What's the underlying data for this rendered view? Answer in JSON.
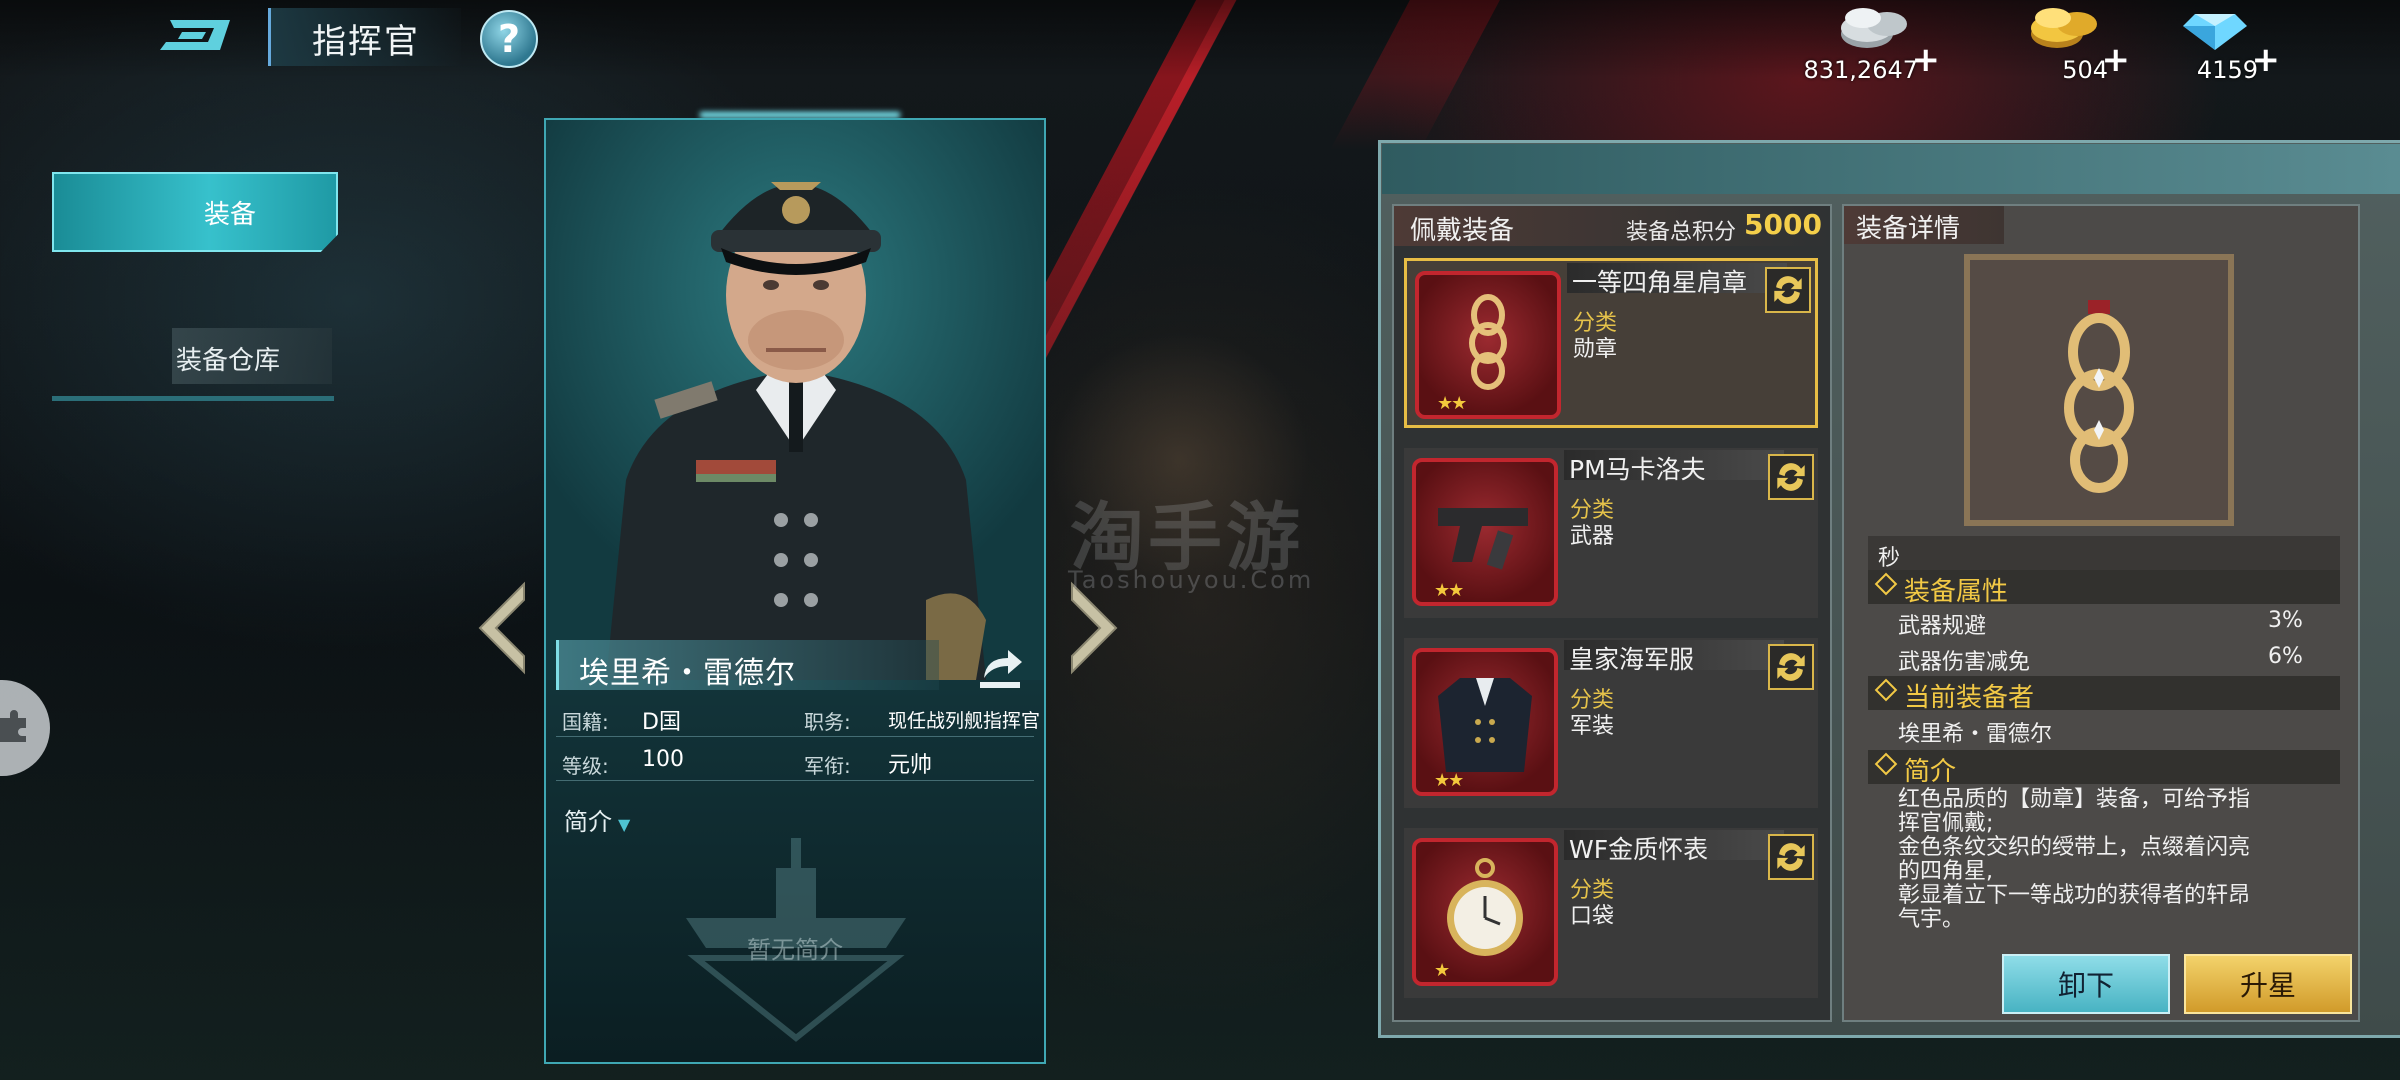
{
  "header": {
    "title": "指挥官"
  },
  "currencies": [
    {
      "name": "silver",
      "value": "831,2647",
      "plus": "+"
    },
    {
      "name": "gold",
      "value": "504",
      "plus": "+"
    },
    {
      "name": "diamond",
      "value": "4159",
      "plus": "+"
    }
  ],
  "menu": {
    "equip": "装备",
    "warehouse": "装备仓库"
  },
  "commander": {
    "name": "埃里希・雷德尔",
    "nationality_label": "国籍:",
    "nationality": "D国",
    "position_label": "职务:",
    "position": "现任战列舰指挥官",
    "level_label": "等级:",
    "level": "100",
    "rank_label": "军衔:",
    "rank": "元帅",
    "intro_label": "简介",
    "no_intro": "暂无简介"
  },
  "watermark": {
    "main": "淘手游",
    "sub": "Taoshouyou.Com"
  },
  "equipment": {
    "header": "佩戴装备",
    "score_label": "装备总积分",
    "score": "5000",
    "category_label": "分类",
    "items": [
      {
        "name": "一等四角星肩章",
        "category": "勋章",
        "stars": "★★"
      },
      {
        "name": "PM马卡洛夫",
        "category": "武器",
        "stars": "★★"
      },
      {
        "name": "皇家海军服",
        "category": "军装",
        "stars": "★★"
      },
      {
        "name": "WF金质怀表",
        "category": "口袋",
        "stars": "★"
      }
    ]
  },
  "detail": {
    "header": "装备详情",
    "top_text": "秒",
    "attr_title": "装备属性",
    "attrs": [
      {
        "name": "武器规避",
        "value": "3%"
      },
      {
        "name": "武器伤害减免",
        "value": "6%"
      }
    ],
    "owner_title": "当前装备者",
    "owner": "埃里希・雷德尔",
    "intro_title": "简介",
    "intro_lines": [
      "红色品质的【勋章】装备，可给予指",
      "挥官佩戴;",
      "金色条纹交织的绶带上，点缀着闪亮",
      "的四角星,",
      "彰显着立下一等战功的获得者的轩昂",
      "气宇。"
    ],
    "unequip_button": "卸下",
    "upgrade_button": "升星"
  }
}
